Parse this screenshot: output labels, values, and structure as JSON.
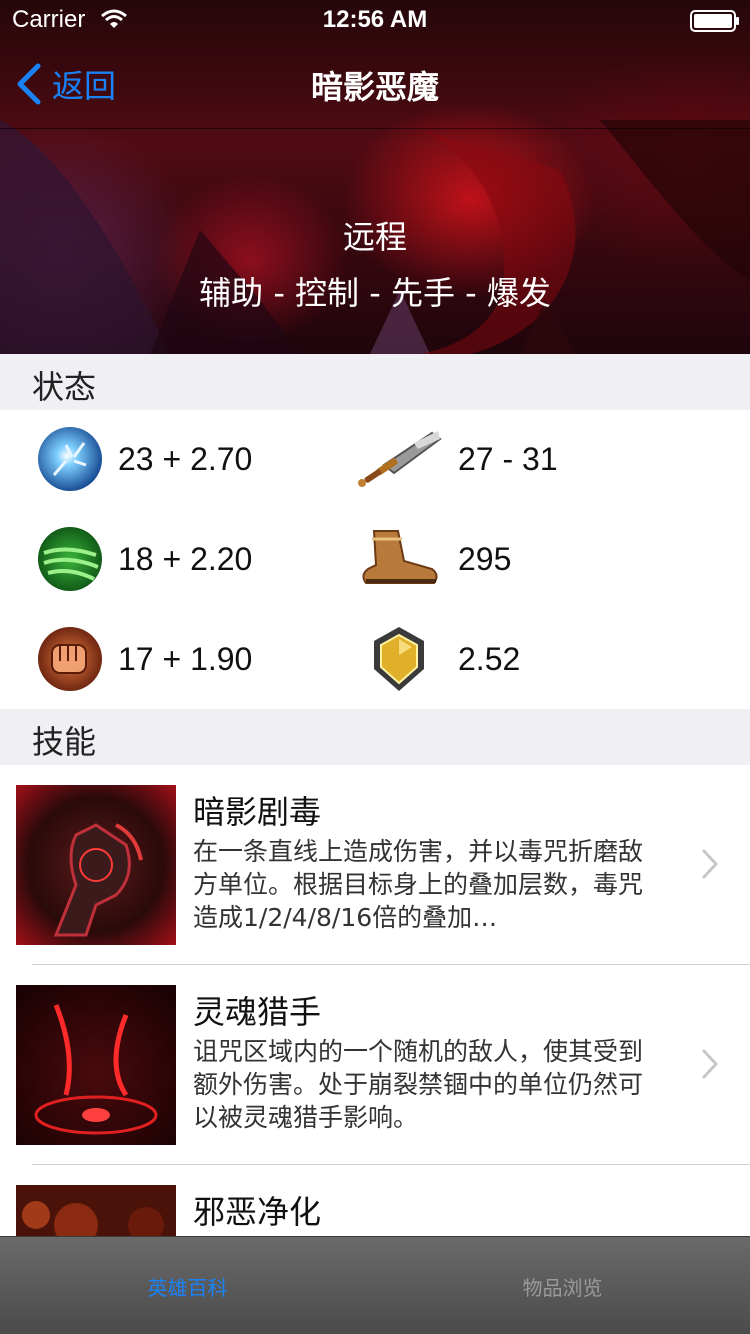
{
  "status_bar": {
    "carrier": "Carrier",
    "time": "12:56 AM"
  },
  "nav": {
    "back_label": "返回",
    "title": "暗影恶魔"
  },
  "hero": {
    "range": "远程",
    "roles": "辅助 - 控制 - 先手 - 爆发"
  },
  "sections": {
    "stats_title": "状态",
    "skills_title": "技能"
  },
  "stats": [
    {
      "icon": "intelligence-icon",
      "value": "23 + 2.70"
    },
    {
      "icon": "sword-icon",
      "value": "27 - 31"
    },
    {
      "icon": "agility-icon",
      "value": "18 + 2.20"
    },
    {
      "icon": "boots-icon",
      "value": "295"
    },
    {
      "icon": "strength-icon",
      "value": "17 + 1.90"
    },
    {
      "icon": "armor-shield-icon",
      "value": "2.52"
    }
  ],
  "skills": [
    {
      "name": "暗影剧毒",
      "description": "在一条直线上造成伤害，并以毒咒折磨敌方单位。根据目标身上的叠加层数，毒咒造成1/2/4/8/16倍的叠加…"
    },
    {
      "name": "灵魂猎手",
      "description": "诅咒区域内的一个随机的敌人，使其受到额外伤害。处于崩裂禁锢中的单位仍然可以被灵魂猎手影响。"
    },
    {
      "name": "邪恶净化",
      "description": ""
    }
  ],
  "tabs": [
    {
      "label": "英雄百科",
      "active": true
    },
    {
      "label": "物品浏览",
      "active": false
    }
  ],
  "colors": {
    "accent": "#1a82f7",
    "section_bg": "#efeff4",
    "tab_bar": "#4b4b4b"
  }
}
